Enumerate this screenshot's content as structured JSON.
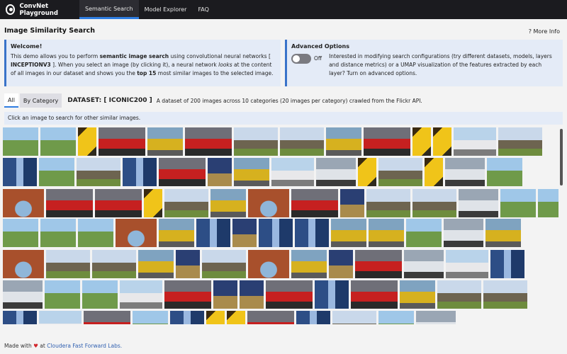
{
  "nav": {
    "brand": "ConvNet Playground",
    "tabs": [
      {
        "label": "Semantic Search",
        "active": true
      },
      {
        "label": "Model Explorer",
        "active": false
      },
      {
        "label": "FAQ",
        "active": false
      }
    ]
  },
  "page": {
    "title": "Image Similarity Search",
    "more_info": "? More Info"
  },
  "welcome": {
    "title": "Welcome!",
    "text_1": "This demo allows you to perform ",
    "bold_1": "semantic image search",
    "text_2": " using convolutional neural networks [ ",
    "bold_2": "INCEPTIONV3",
    "text_3": " ]. When you select an image (by clicking it), a neural network ",
    "italic_1": "looks",
    "text_4": " at the content of all images in our dataset and shows you the ",
    "bold_3": "top 15",
    "text_5": " most similar images to the selected image."
  },
  "advanced": {
    "title": "Advanced Options",
    "toggle_state": "Off",
    "text": "Interested in modifying search configurations (try different datasets, models, layers and distance metrics) or a UMAP visualization of the features extracted by each layer? Turn on advanced options."
  },
  "categories": {
    "all_label": "All",
    "by_category_label": "By Category",
    "dataset_name": "DATASET: [ ICONIC200 ]",
    "dataset_desc": "A dataset of 200 images across 10 categories (20 images per category) crawled from the Flickr API."
  },
  "hint": "Click an image to search for other similar images.",
  "footer": {
    "made_with": "Made with",
    "heart": "♥",
    "at": "at",
    "org": "Cloudera Fast Forward Labs."
  },
  "colors": {
    "nav_bg": "#1b1b1f",
    "accent": "#2f7de1",
    "panel_bg": "#e4ebf7",
    "panel_border": "#3a73c9"
  },
  "gallery": {
    "categories": [
      "tractor",
      "sports-car",
      "banana",
      "pickup-truck",
      "beetle",
      "stonehenge",
      "skyscraper",
      "eiffel-tower",
      "arch",
      "sedan"
    ],
    "rows": [
      [
        "tractor",
        "tractor",
        "banana",
        "sports-car",
        "beetle",
        "sports-car",
        "stonehenge",
        "stonehenge",
        "beetle",
        "sports-car",
        "banana",
        "banana",
        "pickup-truck",
        "stonehenge"
      ],
      [
        "skyscraper",
        "tractor",
        "stonehenge",
        "skyscraper",
        "sports-car",
        "eiffel-tower",
        "beetle",
        "pickup-truck",
        "sedan",
        "banana",
        "stonehenge",
        "banana",
        "sedan",
        "tractor"
      ],
      [
        "arch",
        "sports-car",
        "sports-car",
        "banana",
        "stonehenge",
        "beetle",
        "arch",
        "sports-car",
        "eiffel-tower",
        "stonehenge",
        "stonehenge",
        "sedan",
        "tractor",
        "tractor"
      ],
      [
        "tractor",
        "tractor",
        "tractor",
        "arch",
        "beetle",
        "skyscraper",
        "eiffel-tower",
        "skyscraper",
        "skyscraper",
        "beetle",
        "beetle",
        "tractor",
        "sedan",
        "beetle"
      ],
      [
        "arch",
        "stonehenge",
        "stonehenge",
        "beetle",
        "eiffel-tower",
        "stonehenge",
        "arch",
        "beetle",
        "eiffel-tower",
        "sports-car",
        "sedan",
        "pickup-truck",
        "skyscraper"
      ],
      [
        "sedan",
        "tractor",
        "tractor",
        "pickup-truck",
        "sports-car",
        "eiffel-tower",
        "eiffel-tower",
        "sports-car",
        "skyscraper",
        "sports-car",
        "beetle",
        "stonehenge",
        "stonehenge"
      ],
      [
        "skyscraper",
        "pickup-truck",
        "sports-car",
        "tractor",
        "skyscraper",
        "banana",
        "banana",
        "sports-car",
        "skyscraper",
        "stonehenge",
        "tractor",
        "sedan"
      ]
    ]
  }
}
